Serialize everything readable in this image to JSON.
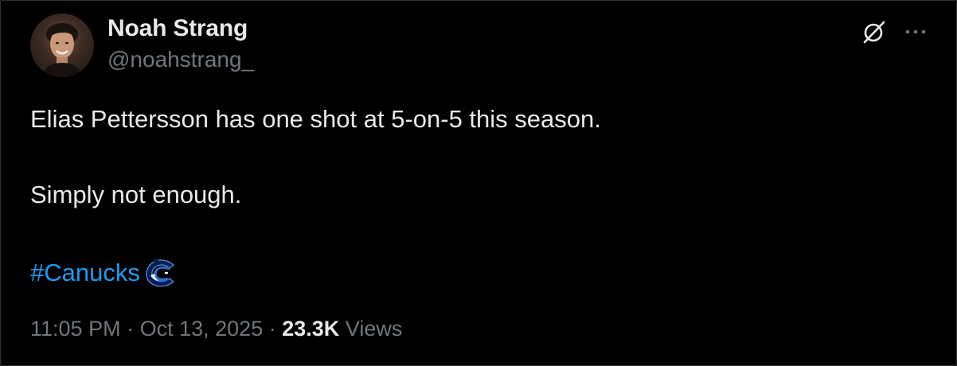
{
  "author": {
    "display_name": "Noah Strang",
    "handle": "@noahstrang_"
  },
  "tweet": {
    "lines": [
      "Elias Pettersson has one shot at 5-on-5 this season.",
      "Simply not enough."
    ],
    "hashtag": "#Canucks"
  },
  "meta": {
    "time": "11:05 PM",
    "separator": "·",
    "date": "Oct 13, 2025",
    "views_count": "23.3K",
    "views_label": "Views"
  },
  "icons": {
    "grok": "grok-icon",
    "more": "more-icon",
    "team": "canucks-logo-icon"
  },
  "colors": {
    "background": "#000000",
    "text": "#e7e9ea",
    "secondary": "#71767b",
    "link": "#1d9bf0",
    "border": "#2f3336"
  }
}
